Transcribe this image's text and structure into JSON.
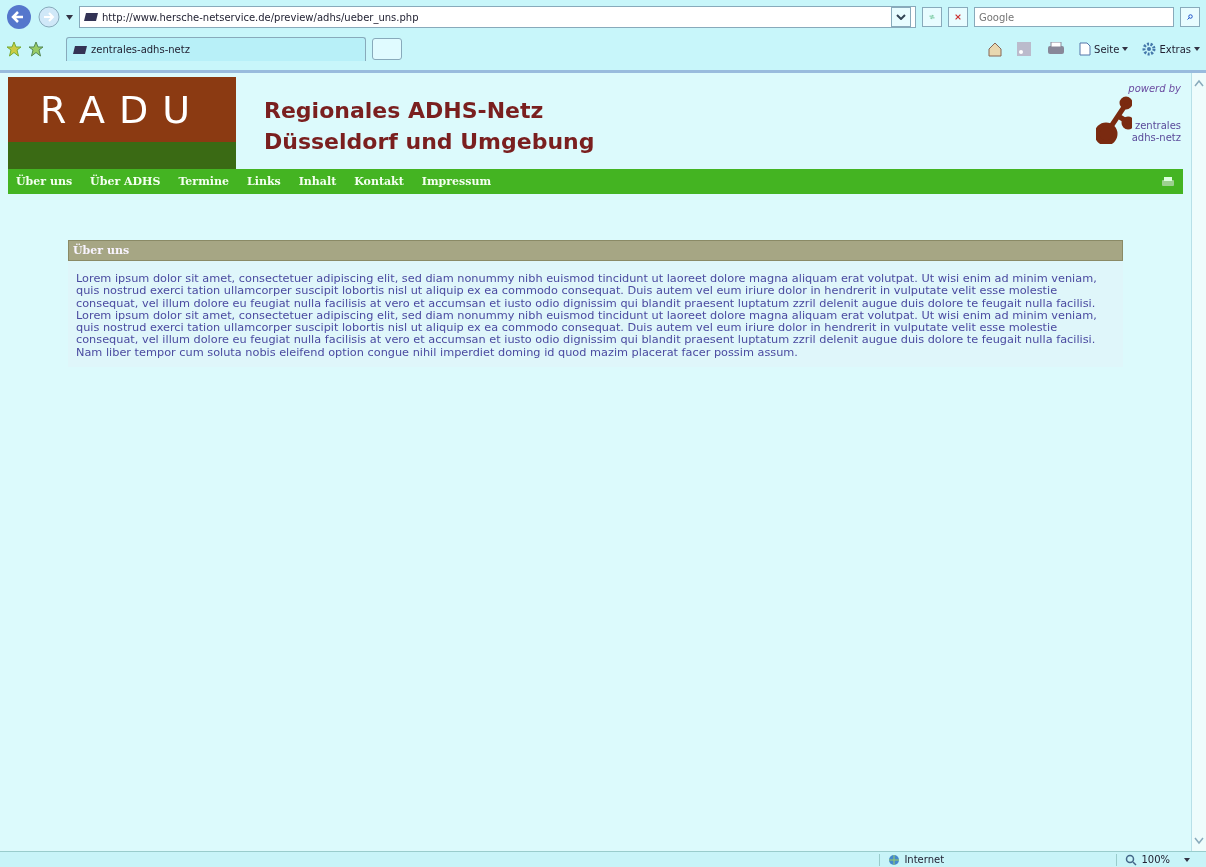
{
  "browser": {
    "address": "http://www.hersche-netservice.de/preview/adhs/ueber_uns.php",
    "search": {
      "placeholder": "Google"
    },
    "tab": "zentrales-adhs-netz",
    "toolbar": [
      "Seite",
      "Extras"
    ]
  },
  "header": {
    "logo": "RADU",
    "title_lines": [
      "Regionales ADHS-Netz",
      "Düsseldorf und Umgebung"
    ],
    "powered_by": "powerd by",
    "partner_lines": [
      "zentrales",
      "adhs-netz"
    ]
  },
  "nav": {
    "items": [
      "Über uns",
      "Über ADHS",
      "Termine",
      "Links",
      "Inhalt",
      "Kontakt",
      "Impressum"
    ]
  },
  "content": {
    "heading": "Über uns",
    "text": "Lorem ipsum dolor sit amet, consectetuer adipiscing elit, sed diam nonummy nibh euismod tincidunt ut laoreet dolore magna aliquam erat volutpat. Ut wisi enim ad minim veniam, quis nostrud exerci tation ullamcorper suscipit lobortis nisl ut aliquip ex ea commodo consequat. Duis autem vel eum iriure dolor in hendrerit in vulputate velit esse molestie consequat, vel illum dolore eu feugiat nulla facilisis at vero et accumsan et iusto odio dignissim qui blandit praesent luptatum zzril delenit augue duis dolore te feugait nulla facilisi. Lorem ipsum dolor sit amet, consectetuer adipiscing elit, sed diam nonummy nibh euismod tincidunt ut laoreet dolore magna aliquam erat volutpat. Ut wisi enim ad minim veniam, quis nostrud exerci tation ullamcorper suscipit lobortis nisl ut aliquip ex ea commodo consequat. Duis autem vel eum iriure dolor in hendrerit in vulputate velit esse molestie consequat, vel illum dolore eu feugiat nulla facilisis at vero et accumsan et iusto odio dignissim qui blandit praesent luptatum zzril delenit augue duis dolore te feugait nulla facilisi. Nam liber tempor cum soluta nobis eleifend option congue nihil imperdiet doming id quod mazim placerat facer possim assum."
  },
  "status_bar": {
    "zone": "Internet",
    "zoom": "100%"
  }
}
